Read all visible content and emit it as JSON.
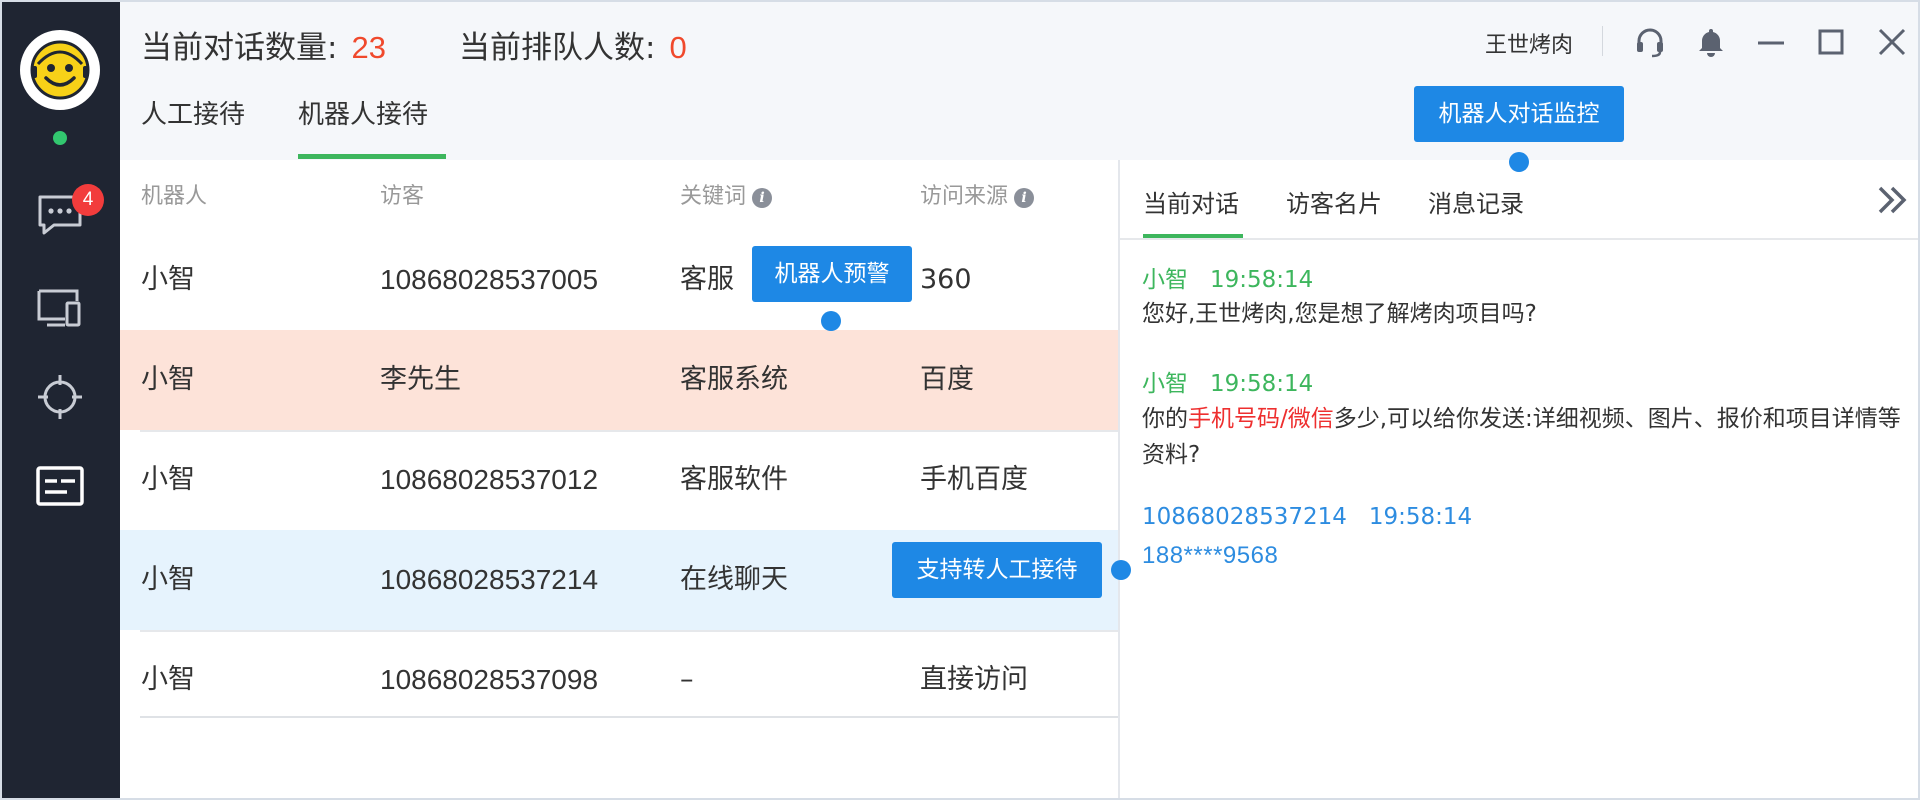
{
  "sidebar": {
    "messages_badge": "4",
    "items": [
      "chat-icon",
      "device-icon",
      "target-icon",
      "card-icon"
    ]
  },
  "header": {
    "conversations_label": "当前对话数量:",
    "conversations_value": "23",
    "queue_label": "当前排队人数:",
    "queue_value": "0",
    "tabs": [
      {
        "label": "人工接待",
        "active": false
      },
      {
        "label": "机器人接待",
        "active": true
      }
    ],
    "user_name": "王世烤肉",
    "icons": [
      "headset-icon",
      "bell-icon",
      "minimize-icon",
      "maximize-icon",
      "close-icon"
    ]
  },
  "callouts": {
    "robot_monitor": "机器人对话监控",
    "robot_alert": "机器人预警",
    "transfer_human": "支持转人工接待"
  },
  "table": {
    "headers": [
      "机器人",
      "访客",
      "关键词",
      "访问来源"
    ],
    "rows": [
      {
        "robot": "小智",
        "visitor": "10868028537005",
        "keyword": "客服",
        "source": "360",
        "state": "normal"
      },
      {
        "robot": "小智",
        "visitor": "李先生",
        "keyword": "客服系统",
        "source": "百度",
        "state": "alert"
      },
      {
        "robot": "小智",
        "visitor": "10868028537012",
        "keyword": "客服软件",
        "source": "手机百度",
        "state": "normal"
      },
      {
        "robot": "小智",
        "visitor": "10868028537214",
        "keyword": "在线聊天",
        "source": "",
        "state": "selected"
      },
      {
        "robot": "小智",
        "visitor": "10868028537098",
        "keyword": "–",
        "source": "直接访问",
        "state": "normal"
      }
    ]
  },
  "panel": {
    "tabs": [
      {
        "label": "当前对话",
        "active": true
      },
      {
        "label": "访客名片",
        "active": false
      },
      {
        "label": "消息记录",
        "active": false
      }
    ],
    "messages": [
      {
        "sender": "小智",
        "time": "19:58:14",
        "text": "您好,王世烤肉,您是想了解烤肉项目吗?"
      },
      {
        "sender": "小智",
        "time": "19:58:14",
        "text_before": "你的",
        "text_highlight": "手机号码/微信",
        "text_after": "多少,可以给你发送:详细视频、图片、报价和项目详情等资料?"
      },
      {
        "sender": "10868028537214",
        "time": "19:58:14",
        "text": "188****9568"
      }
    ]
  },
  "colors": {
    "rail": "#1f2532",
    "accent_green": "#3db65d",
    "accent_blue": "#1e88e5",
    "alert_row": "#fde3d9",
    "selected_row": "#e6f3fd",
    "stat_value": "#f0492c",
    "highlight_red": "#ee2f2f"
  }
}
